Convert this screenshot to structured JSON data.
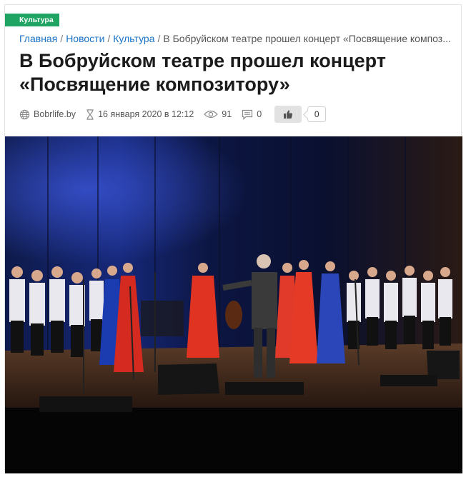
{
  "category": "Культура",
  "breadcrumb": {
    "home": "Главная",
    "news": "Новости",
    "section": "Культура",
    "current": "В Бобруйском театре прошел концерт «Посвящение композ..."
  },
  "title": "В Бобруйском театре прошел концерт «Посвящение композитору»",
  "meta": {
    "source": "Bobrlife.by",
    "date": "16 января 2020 в 12:12",
    "views": "91",
    "comments": "0",
    "likes": "0"
  },
  "icons": [
    "globe-icon",
    "hourglass-icon",
    "eye-icon",
    "comment-icon",
    "thumbs-up-icon"
  ],
  "colors": {
    "badge": "#1fa463",
    "link": "#1a73c7"
  }
}
